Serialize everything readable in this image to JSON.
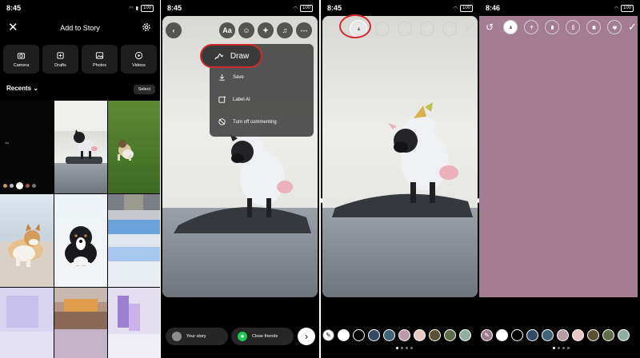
{
  "screen1": {
    "status": {
      "time": "8:45",
      "battery": "100"
    },
    "title": "Add to Story",
    "tools": [
      {
        "label": "Camera",
        "icon": "camera-icon"
      },
      {
        "label": "Drafts",
        "icon": "drafts-icon"
      },
      {
        "label": "Photos",
        "icon": "photos-icon"
      },
      {
        "label": "Videos",
        "icon": "videos-icon"
      }
    ],
    "recents_label": "Recents",
    "select_label": "Select",
    "cell_text": "Aa"
  },
  "screen2": {
    "status": {
      "time": "8:45",
      "battery": "100"
    },
    "toolbar_text": "Aa",
    "menu": {
      "draw": "Draw",
      "save": "Save",
      "label_ai": "Label AI",
      "turn_off_commenting": "Turn off commenting"
    },
    "your_story": "Your story",
    "close_friends": "Close friends"
  },
  "screen3": {
    "status": {
      "time": "8:45",
      "battery": "100"
    }
  },
  "screen4": {
    "status": {
      "time": "8:46",
      "battery": "100"
    },
    "canvas_color": "#a57d92"
  },
  "palette_colors": [
    "#ffffff",
    "#000000",
    "#324a63",
    "#3f6478",
    "#b89aa8",
    "#e9c7c5",
    "#5b5135",
    "#5e6e4a",
    "#8fae9f"
  ],
  "accent_red": "#d42a2a"
}
